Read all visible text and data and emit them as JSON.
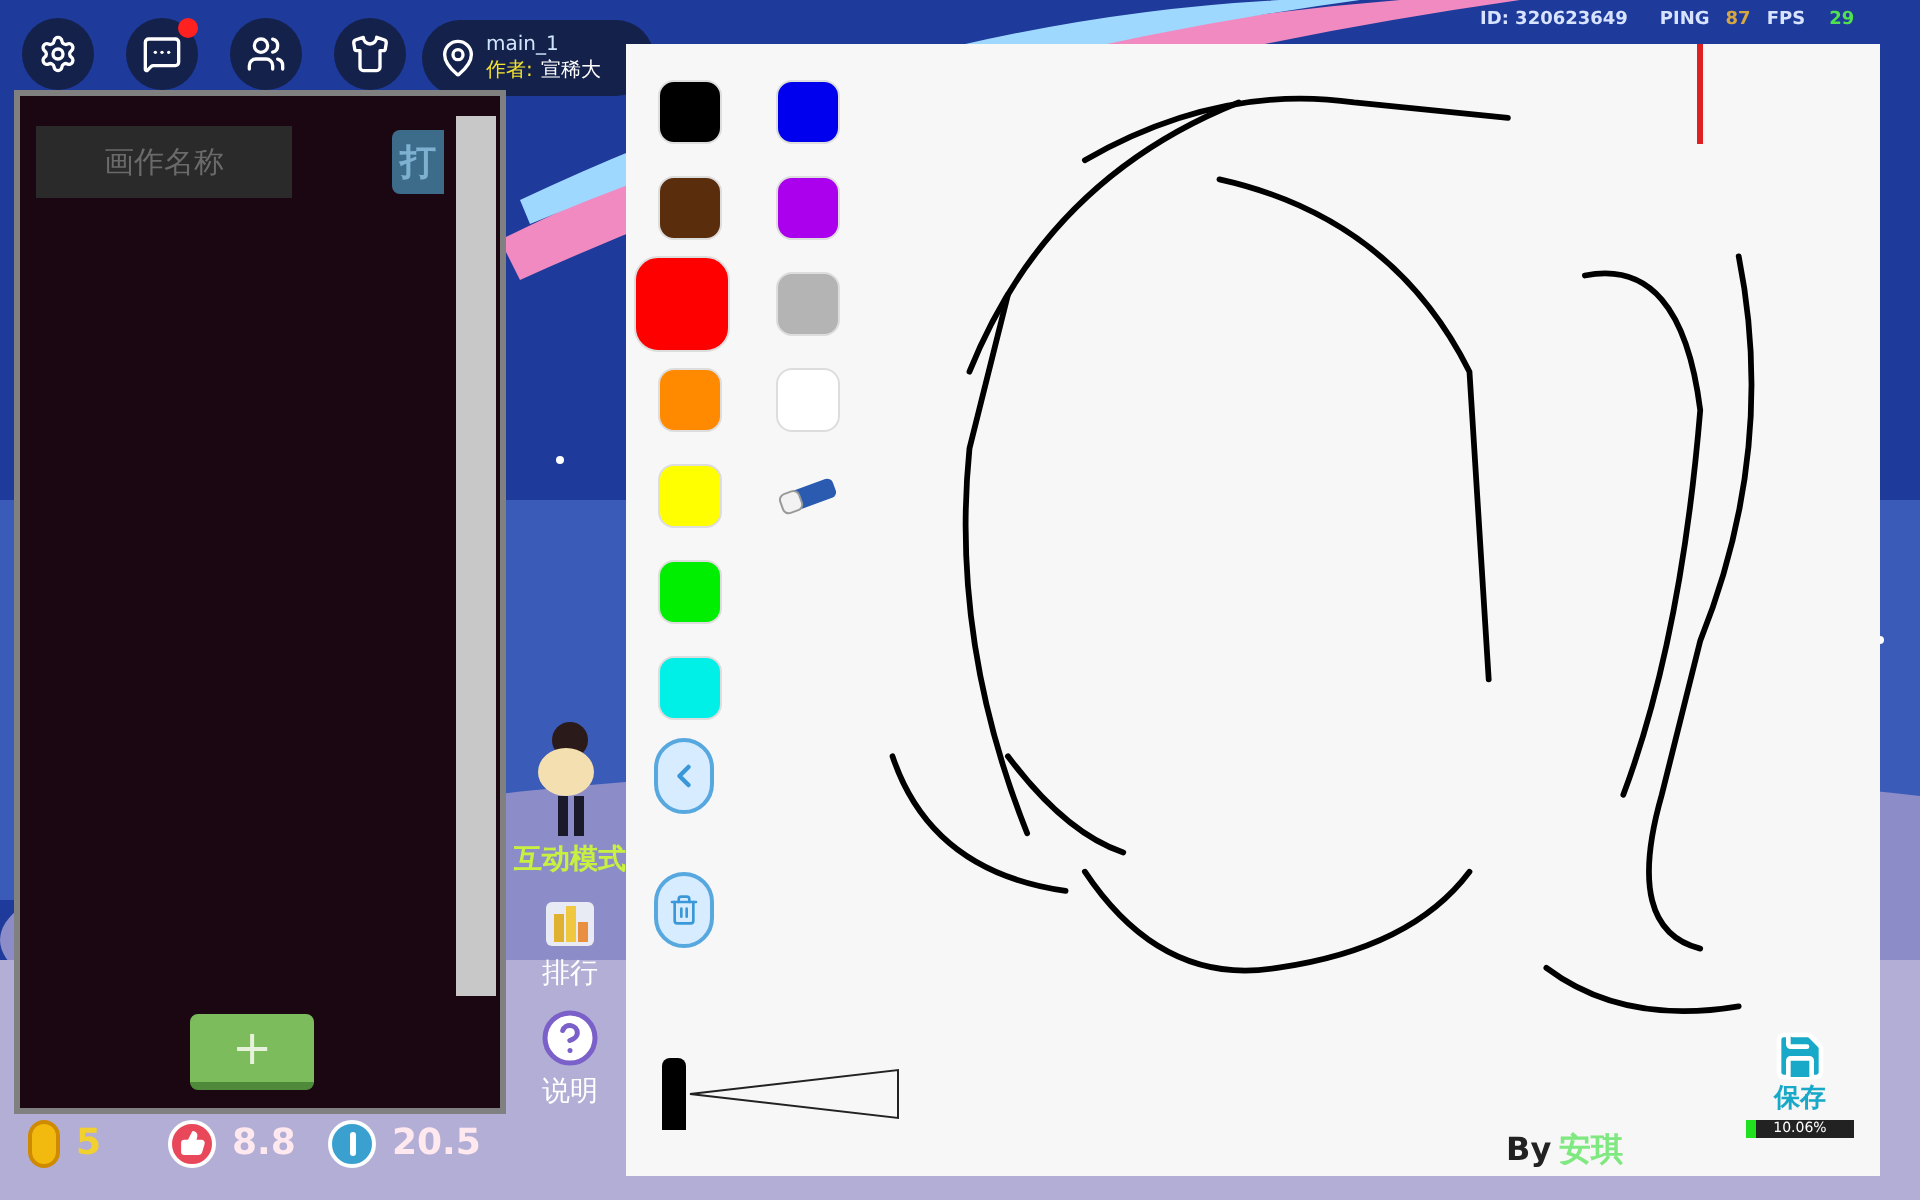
{
  "top_bar": {
    "icons": [
      {
        "kind": "settings",
        "badge": false
      },
      {
        "kind": "chat",
        "badge": true
      },
      {
        "kind": "friends",
        "badge": false
      },
      {
        "kind": "wardrobe",
        "badge": false
      }
    ],
    "map": {
      "name": "main_1",
      "author_label": "作者:",
      "author": "宣稀大"
    }
  },
  "status": {
    "id": "ID: 320623649",
    "ping_label": "PING",
    "ping": "87",
    "fps_label": "FPS",
    "fps": "29"
  },
  "gallery": {
    "name_placeholder": "画作名称",
    "open_button": "打",
    "add_button": "+"
  },
  "stats": [
    {
      "kind": "coin",
      "value": "5"
    },
    {
      "kind": "like",
      "value": "8.8"
    },
    {
      "kind": "info",
      "value": "20.5"
    }
  ],
  "side": {
    "mode": "互动模式",
    "buttons": [
      {
        "kind": "rank",
        "label": "排行"
      },
      {
        "kind": "help",
        "label": "说明"
      }
    ]
  },
  "canvas": {
    "left_column": [
      {
        "kind": "color",
        "color": "#000000",
        "selected": false
      },
      {
        "kind": "color",
        "color": "#5a2d0c",
        "selected": false
      },
      {
        "kind": "color",
        "color": "#ff0000",
        "selected": true
      },
      {
        "kind": "color",
        "color": "#ff8a00",
        "selected": false
      },
      {
        "kind": "color",
        "color": "#ffff00",
        "selected": false
      },
      {
        "kind": "color",
        "color": "#00ee00",
        "selected": false
      },
      {
        "kind": "color",
        "color": "#00f0e8",
        "selected": false
      }
    ],
    "right_column": [
      {
        "kind": "color",
        "color": "#0000ee",
        "selected": false
      },
      {
        "kind": "color",
        "color": "#aa00ee",
        "selected": false
      },
      {
        "kind": "color",
        "color": "#b4b4b4",
        "selected": false
      },
      {
        "kind": "color",
        "color": "#ffffff",
        "selected": false
      },
      {
        "kind": "eraser",
        "selected": false
      }
    ],
    "brush": {
      "level": 0
    },
    "credit_prefix": "By",
    "artist": "安琪",
    "save": {
      "label": "保存",
      "progress": {
        "level": 0.1006,
        "reading": "10.06%"
      }
    }
  }
}
